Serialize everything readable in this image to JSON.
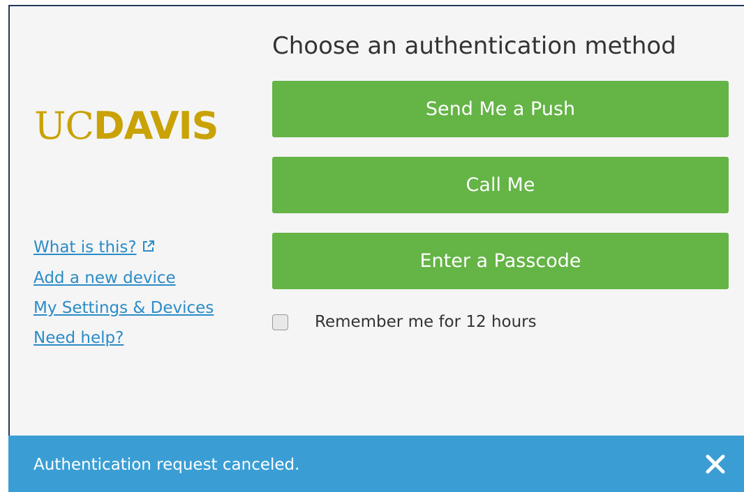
{
  "logo": {
    "uc": "UC",
    "davis": "DAVIS",
    "color": "#c9a206"
  },
  "title": "Choose an authentication method",
  "links": {
    "what_is_this": "What is this?",
    "external_icon": "external-link-icon",
    "add_device": "Add a new device",
    "settings": "My Settings & Devices",
    "help": "Need help?"
  },
  "buttons": {
    "push": "Send Me a Push",
    "call": "Call Me",
    "passcode": "Enter a Passcode",
    "color": "#64b446"
  },
  "remember": {
    "label": "Remember me for 12 hours",
    "checked": false
  },
  "banner": {
    "message": "Authentication request canceled.",
    "close_icon": "close-icon",
    "color": "#3a9ed5"
  }
}
